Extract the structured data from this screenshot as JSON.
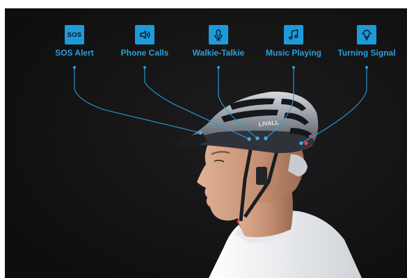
{
  "colors": {
    "accent": "#2aa0db",
    "icon_fill": "#1f9ad9",
    "icon_glyph": "#0b1620",
    "background": "#141414",
    "skin": "#c7977c",
    "jersey": "#f2f3f5",
    "helmet_dark": "#3a3e45",
    "helmet_silver": "#b7bcc3"
  },
  "features": [
    {
      "icon": "sos-icon",
      "icon_text": "SOS",
      "label": "SOS Alert"
    },
    {
      "icon": "phone-speaker-icon",
      "label": "Phone Calls"
    },
    {
      "icon": "microphone-icon",
      "label": "Walkie-Talkie"
    },
    {
      "icon": "music-note-icon",
      "label": "Music Playing"
    },
    {
      "icon": "lightbulb-icon",
      "label": "Turning Signal"
    }
  ],
  "helmet": {
    "brand_logo": "LIVALL"
  }
}
